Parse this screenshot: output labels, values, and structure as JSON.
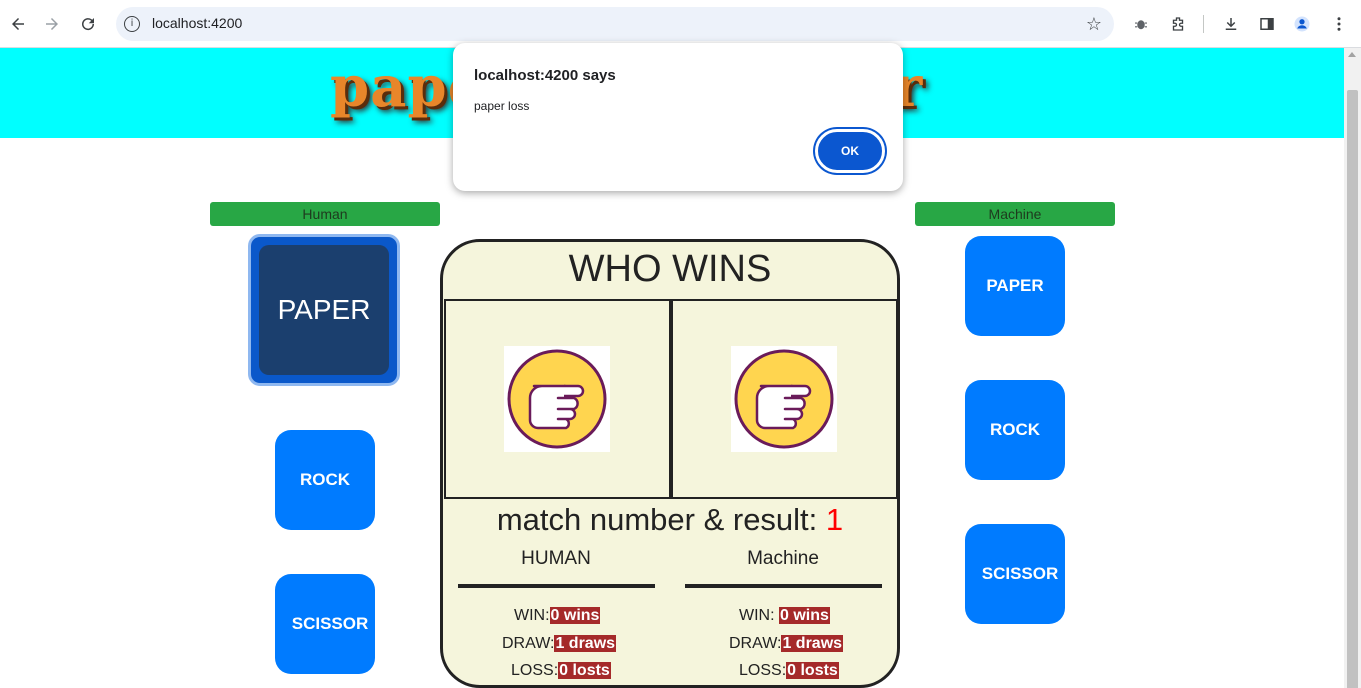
{
  "browser": {
    "url": "localhost:4200"
  },
  "app": {
    "logo_text": "paper rock scissor"
  },
  "human": {
    "label": "Human",
    "choices": [
      "PAPER",
      "ROCK",
      "SCISSOR"
    ],
    "selected": "PAPER"
  },
  "machine": {
    "label": "Machine",
    "choices": [
      "PAPER",
      "ROCK",
      "SCISSOR"
    ]
  },
  "board": {
    "title": "WHO WINS",
    "result_label": "match number & result: ",
    "match_number": "1",
    "human_heading": "HUMAN",
    "machine_heading": "Machine",
    "human_stats": {
      "win_label": "WIN:",
      "win_value": "0 wins",
      "draw_label": "DRAW:",
      "draw_value": "1 draws",
      "loss_label": "LOSS:",
      "loss_value": "0 losts"
    },
    "machine_stats": {
      "win_label": "WIN: ",
      "win_value": "0 wins",
      "draw_label": "DRAW:",
      "draw_value": "1 draws",
      "loss_label": "LOSS:",
      "loss_value": "0 losts"
    }
  },
  "dialog": {
    "title": "localhost:4200 says",
    "message": "paper loss",
    "ok_label": "OK"
  },
  "colors": {
    "banner": "#00ffff",
    "choice_button": "#007bff",
    "label_bar": "#28a745",
    "board_bg": "#f5f5dc",
    "stat_badge": "#a52a2a",
    "match_number": "#ff0000"
  }
}
